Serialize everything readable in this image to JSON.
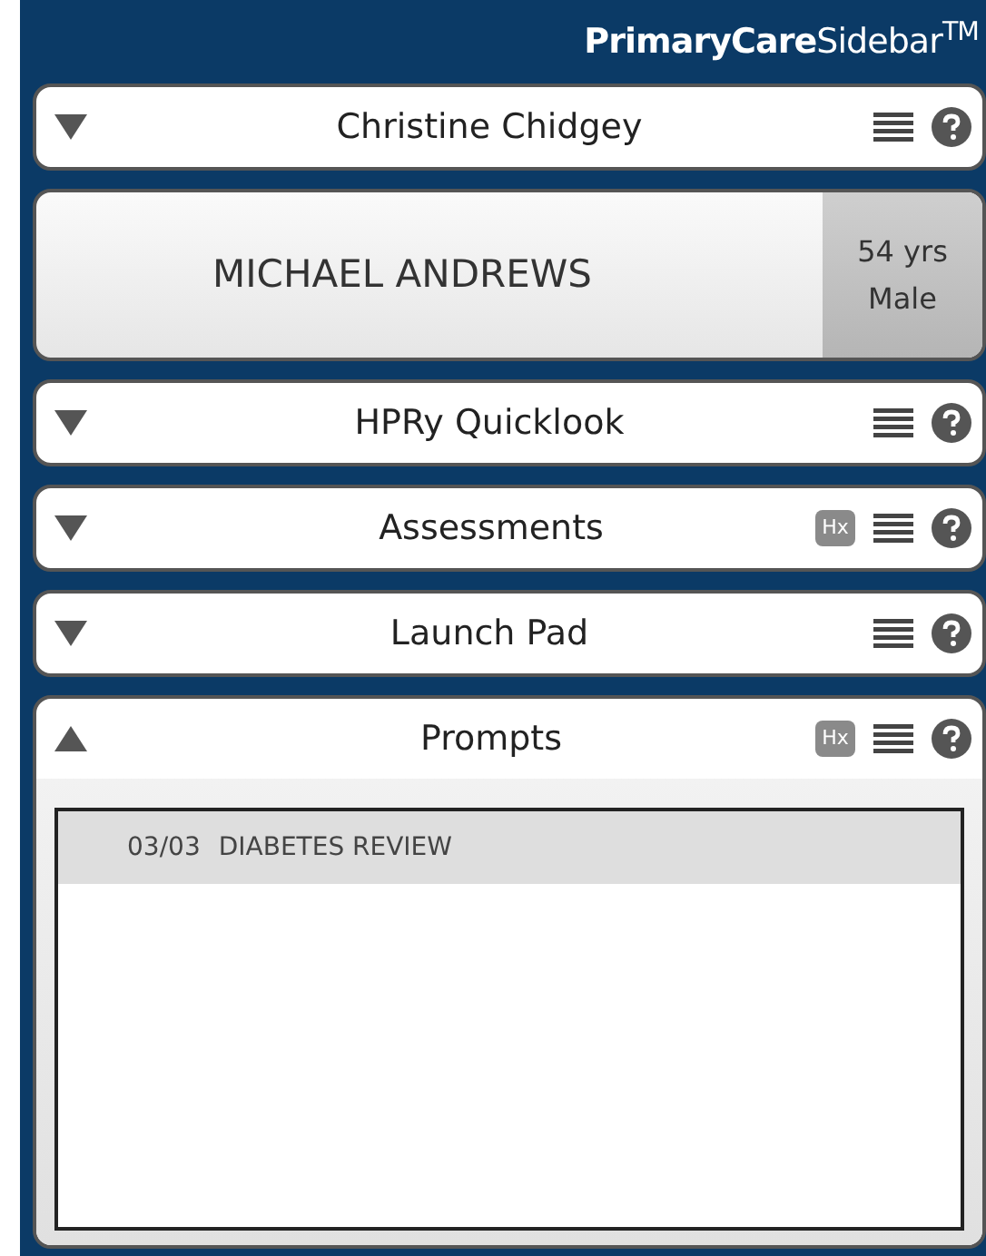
{
  "header": {
    "title": "**PrimaryCare**Sidebar$^{TM}$"
  },
  "panels": [
    {
      "kind": "section",
      "label": "Christine Chidgey",
      "expanded": false
    },
    {
      "kind": "patient",
      "name": "MICHAEL ANDREWS",
      "age": "54 yrs",
      "sex": "Male"
    },
    {
      "kind": "section",
      "label": "HPRy Quicklook",
      "expanded": false
    },
    {
      "kind": "section",
      "label": "Assessments",
      "expanded": false,
      "hx": "Hx"
    },
    {
      "kind": "section",
      "label": "Launch Pad",
      "expanded": false
    },
    {
      "kind": "section",
      "label": "Prompts",
      "expanded": true,
      "hx": "Hx",
      "items": [
        {
          "date": "03/03",
          "text": "DIABETES REVIEW",
          "selected": true
        }
      ]
    }
  ]
}
